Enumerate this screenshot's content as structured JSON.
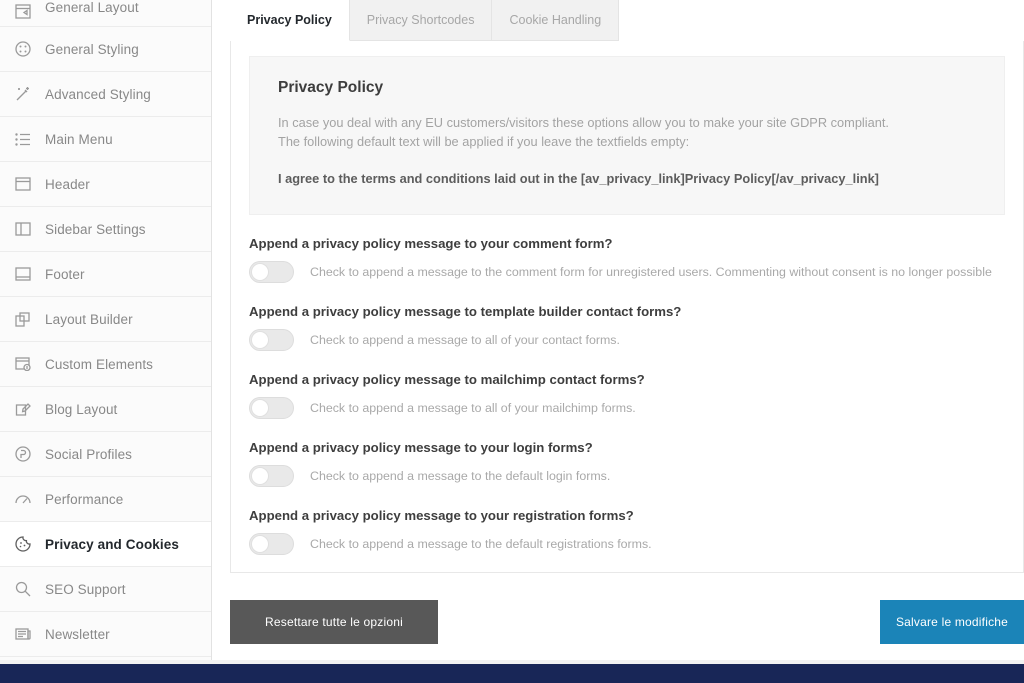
{
  "sidebar": {
    "items": [
      {
        "label": "General Layout",
        "icon": "layout-icon",
        "active": false
      },
      {
        "label": "General Styling",
        "icon": "palette-icon",
        "active": false
      },
      {
        "label": "Advanced Styling",
        "icon": "magic-wand-icon",
        "active": false
      },
      {
        "label": "Main Menu",
        "icon": "list-icon",
        "active": false
      },
      {
        "label": "Header",
        "icon": "header-icon",
        "active": false
      },
      {
        "label": "Sidebar Settings",
        "icon": "sidebar-icon",
        "active": false
      },
      {
        "label": "Footer",
        "icon": "footer-icon",
        "active": false
      },
      {
        "label": "Layout Builder",
        "icon": "builder-icon",
        "active": false
      },
      {
        "label": "Custom Elements",
        "icon": "custom-window-icon",
        "active": false
      },
      {
        "label": "Blog Layout",
        "icon": "pencil-note-icon",
        "active": false
      },
      {
        "label": "Social Profiles",
        "icon": "person-circle-icon",
        "active": false
      },
      {
        "label": "Performance",
        "icon": "gauge-icon",
        "active": false
      },
      {
        "label": "Privacy and Cookies",
        "icon": "cookie-icon",
        "active": true
      },
      {
        "label": "SEO Support",
        "icon": "search-icon",
        "active": false
      },
      {
        "label": "Newsletter",
        "icon": "newspaper-icon",
        "active": false
      }
    ]
  },
  "tabs": [
    {
      "label": "Privacy Policy",
      "active": true
    },
    {
      "label": "Privacy Shortcodes",
      "active": false
    },
    {
      "label": "Cookie Handling",
      "active": false
    }
  ],
  "infobox": {
    "title": "Privacy Policy",
    "line1": "In case you deal with any EU customers/visitors these options allow you to make your site GDPR compliant.",
    "line2": "The following default text will be applied if you leave the textfields empty:",
    "line3": "I agree to the terms and conditions laid out in the [av_privacy_link]Privacy Policy[/av_privacy_link]"
  },
  "options": [
    {
      "title": "Append a privacy policy message to your comment form?",
      "description": "Check to append a message to the comment form for unregistered users. Commenting without consent is no longer possible",
      "enabled": false
    },
    {
      "title": "Append a privacy policy message to template builder contact forms?",
      "description": "Check to append a message to all of your contact forms.",
      "enabled": false
    },
    {
      "title": "Append a privacy policy message to mailchimp contact forms?",
      "description": "Check to append a message to all of your mailchimp forms.",
      "enabled": false
    },
    {
      "title": "Append a privacy policy message to your login forms?",
      "description": "Check to append a message to the default login forms.",
      "enabled": false
    },
    {
      "title": "Append a privacy policy message to your registration forms?",
      "description": "Check to append a message to the default registrations forms.",
      "enabled": false
    }
  ],
  "footer": {
    "reset_label": "Resettare tutte le opzioni",
    "save_label": "Salvare le modifiche"
  },
  "colors": {
    "accent_blue": "#1b84b8",
    "reset_gray": "#585858",
    "bottom_bar_navy": "#182657",
    "infobox_bg": "#f7f7f7"
  }
}
